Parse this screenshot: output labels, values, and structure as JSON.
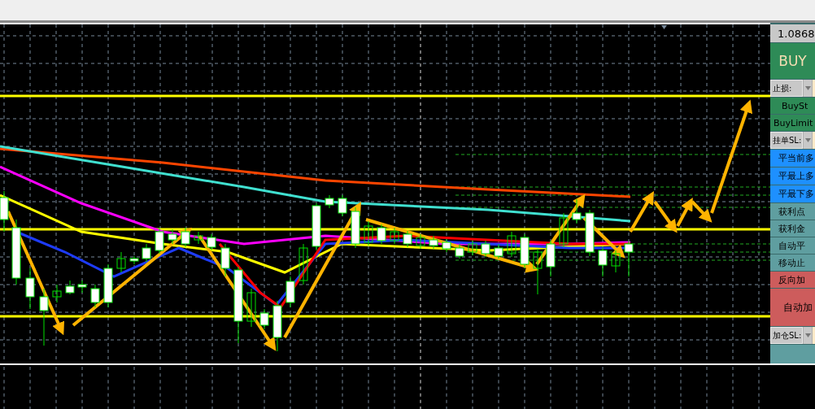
{
  "price_label": "1.0868",
  "panel": [
    {
      "kind": "trade",
      "label": "BUY"
    },
    {
      "kind": "selector",
      "label": "止损:"
    },
    {
      "kind": "order",
      "label": "BuySt"
    },
    {
      "kind": "order",
      "label": "BuyLimit"
    },
    {
      "kind": "selector",
      "label": "挂单SL:"
    },
    {
      "kind": "close",
      "label": "平当前多"
    },
    {
      "kind": "close",
      "label": "平最上多"
    },
    {
      "kind": "close",
      "label": "平最下多"
    },
    {
      "kind": "profit",
      "label": "获利点"
    },
    {
      "kind": "profit",
      "label": "获利金"
    },
    {
      "kind": "profit",
      "label": "自动平"
    },
    {
      "kind": "profit",
      "label": "移动止"
    },
    {
      "kind": "reverse",
      "label": "反向加"
    },
    {
      "kind": "auto",
      "label": "自动加"
    },
    {
      "kind": "selector",
      "label": "加仓SL:"
    },
    {
      "kind": "blank"
    }
  ]
}
